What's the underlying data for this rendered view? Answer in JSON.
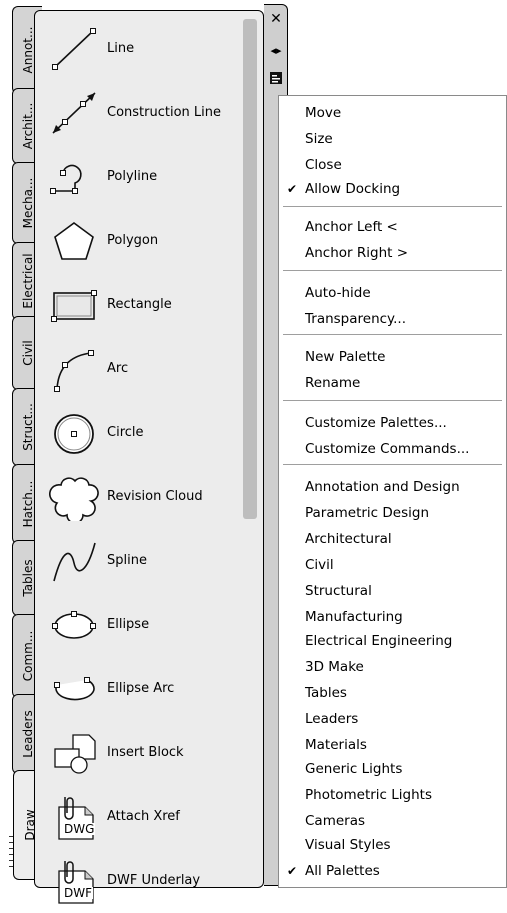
{
  "palette": {
    "tabs": [
      "Annot...",
      "Archit...",
      "Mecha...",
      "Electrical",
      "Civil",
      "Struct...",
      "Hatch...",
      "Tables",
      "Comm...",
      "Leaders",
      "Draw"
    ],
    "active_tab": "Draw",
    "tools": [
      {
        "label": "Line",
        "icon": "line-icon"
      },
      {
        "label": "Construction Line",
        "icon": "construction-line-icon"
      },
      {
        "label": "Polyline",
        "icon": "polyline-icon"
      },
      {
        "label": "Polygon",
        "icon": "polygon-icon"
      },
      {
        "label": "Rectangle",
        "icon": "rectangle-icon"
      },
      {
        "label": "Arc",
        "icon": "arc-icon"
      },
      {
        "label": "Circle",
        "icon": "circle-icon"
      },
      {
        "label": "Revision Cloud",
        "icon": "revision-cloud-icon"
      },
      {
        "label": "Spline",
        "icon": "spline-icon"
      },
      {
        "label": "Ellipse",
        "icon": "ellipse-icon"
      },
      {
        "label": "Ellipse Arc",
        "icon": "ellipse-arc-icon"
      },
      {
        "label": "Insert Block",
        "icon": "insert-block-icon"
      },
      {
        "label": "Attach Xref",
        "icon": "attach-xref-icon",
        "badge": "DWG"
      },
      {
        "label": "DWF Underlay",
        "icon": "dwf-underlay-icon",
        "badge": "DWF"
      }
    ]
  },
  "titlebar": {
    "icons": [
      "close-icon",
      "auto-hide-icon",
      "properties-icon"
    ]
  },
  "context_menu": {
    "groups": [
      [
        {
          "label": "Move"
        },
        {
          "label": "Size"
        },
        {
          "label": "Close"
        },
        {
          "label": "Allow Docking",
          "checked": true
        }
      ],
      [
        {
          "label": "Anchor Left  <"
        },
        {
          "label": "Anchor Right  >"
        }
      ],
      [
        {
          "label": "Auto-hide"
        },
        {
          "label": "Transparency..."
        }
      ],
      [
        {
          "label": "New Palette"
        },
        {
          "label": "Rename"
        }
      ],
      [
        {
          "label": "Customize Palettes..."
        },
        {
          "label": "Customize Commands..."
        }
      ],
      [
        {
          "label": "Annotation and Design"
        },
        {
          "label": "Parametric Design"
        },
        {
          "label": "Architectural"
        },
        {
          "label": "Civil"
        },
        {
          "label": "Structural"
        },
        {
          "label": "Manufacturing"
        },
        {
          "label": "Electrical Engineering"
        },
        {
          "label": "3D Make"
        },
        {
          "label": "Tables"
        },
        {
          "label": "Leaders"
        },
        {
          "label": "Materials"
        },
        {
          "label": "Generic Lights"
        },
        {
          "label": "Photometric Lights"
        },
        {
          "label": "Cameras"
        },
        {
          "label": "Visual Styles"
        },
        {
          "label": "All Palettes",
          "checked": true
        }
      ]
    ]
  }
}
